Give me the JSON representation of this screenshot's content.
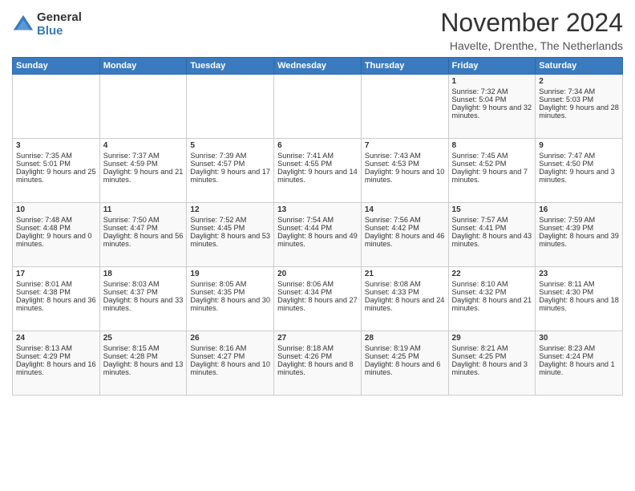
{
  "logo": {
    "general": "General",
    "blue": "Blue"
  },
  "title": "November 2024",
  "location": "Havelte, Drenthe, The Netherlands",
  "days_of_week": [
    "Sunday",
    "Monday",
    "Tuesday",
    "Wednesday",
    "Thursday",
    "Friday",
    "Saturday"
  ],
  "weeks": [
    [
      {
        "day": "",
        "content": ""
      },
      {
        "day": "",
        "content": ""
      },
      {
        "day": "",
        "content": ""
      },
      {
        "day": "",
        "content": ""
      },
      {
        "day": "",
        "content": ""
      },
      {
        "day": "1",
        "content": "Sunrise: 7:32 AM\nSunset: 5:04 PM\nDaylight: 9 hours and 32 minutes."
      },
      {
        "day": "2",
        "content": "Sunrise: 7:34 AM\nSunset: 5:03 PM\nDaylight: 9 hours and 28 minutes."
      }
    ],
    [
      {
        "day": "3",
        "content": "Sunrise: 7:35 AM\nSunset: 5:01 PM\nDaylight: 9 hours and 25 minutes."
      },
      {
        "day": "4",
        "content": "Sunrise: 7:37 AM\nSunset: 4:59 PM\nDaylight: 9 hours and 21 minutes."
      },
      {
        "day": "5",
        "content": "Sunrise: 7:39 AM\nSunset: 4:57 PM\nDaylight: 9 hours and 17 minutes."
      },
      {
        "day": "6",
        "content": "Sunrise: 7:41 AM\nSunset: 4:55 PM\nDaylight: 9 hours and 14 minutes."
      },
      {
        "day": "7",
        "content": "Sunrise: 7:43 AM\nSunset: 4:53 PM\nDaylight: 9 hours and 10 minutes."
      },
      {
        "day": "8",
        "content": "Sunrise: 7:45 AM\nSunset: 4:52 PM\nDaylight: 9 hours and 7 minutes."
      },
      {
        "day": "9",
        "content": "Sunrise: 7:47 AM\nSunset: 4:50 PM\nDaylight: 9 hours and 3 minutes."
      }
    ],
    [
      {
        "day": "10",
        "content": "Sunrise: 7:48 AM\nSunset: 4:48 PM\nDaylight: 9 hours and 0 minutes."
      },
      {
        "day": "11",
        "content": "Sunrise: 7:50 AM\nSunset: 4:47 PM\nDaylight: 8 hours and 56 minutes."
      },
      {
        "day": "12",
        "content": "Sunrise: 7:52 AM\nSunset: 4:45 PM\nDaylight: 8 hours and 53 minutes."
      },
      {
        "day": "13",
        "content": "Sunrise: 7:54 AM\nSunset: 4:44 PM\nDaylight: 8 hours and 49 minutes."
      },
      {
        "day": "14",
        "content": "Sunrise: 7:56 AM\nSunset: 4:42 PM\nDaylight: 8 hours and 46 minutes."
      },
      {
        "day": "15",
        "content": "Sunrise: 7:57 AM\nSunset: 4:41 PM\nDaylight: 8 hours and 43 minutes."
      },
      {
        "day": "16",
        "content": "Sunrise: 7:59 AM\nSunset: 4:39 PM\nDaylight: 8 hours and 39 minutes."
      }
    ],
    [
      {
        "day": "17",
        "content": "Sunrise: 8:01 AM\nSunset: 4:38 PM\nDaylight: 8 hours and 36 minutes."
      },
      {
        "day": "18",
        "content": "Sunrise: 8:03 AM\nSunset: 4:37 PM\nDaylight: 8 hours and 33 minutes."
      },
      {
        "day": "19",
        "content": "Sunrise: 8:05 AM\nSunset: 4:35 PM\nDaylight: 8 hours and 30 minutes."
      },
      {
        "day": "20",
        "content": "Sunrise: 8:06 AM\nSunset: 4:34 PM\nDaylight: 8 hours and 27 minutes."
      },
      {
        "day": "21",
        "content": "Sunrise: 8:08 AM\nSunset: 4:33 PM\nDaylight: 8 hours and 24 minutes."
      },
      {
        "day": "22",
        "content": "Sunrise: 8:10 AM\nSunset: 4:32 PM\nDaylight: 8 hours and 21 minutes."
      },
      {
        "day": "23",
        "content": "Sunrise: 8:11 AM\nSunset: 4:30 PM\nDaylight: 8 hours and 18 minutes."
      }
    ],
    [
      {
        "day": "24",
        "content": "Sunrise: 8:13 AM\nSunset: 4:29 PM\nDaylight: 8 hours and 16 minutes."
      },
      {
        "day": "25",
        "content": "Sunrise: 8:15 AM\nSunset: 4:28 PM\nDaylight: 8 hours and 13 minutes."
      },
      {
        "day": "26",
        "content": "Sunrise: 8:16 AM\nSunset: 4:27 PM\nDaylight: 8 hours and 10 minutes."
      },
      {
        "day": "27",
        "content": "Sunrise: 8:18 AM\nSunset: 4:26 PM\nDaylight: 8 hours and 8 minutes."
      },
      {
        "day": "28",
        "content": "Sunrise: 8:19 AM\nSunset: 4:25 PM\nDaylight: 8 hours and 6 minutes."
      },
      {
        "day": "29",
        "content": "Sunrise: 8:21 AM\nSunset: 4:25 PM\nDaylight: 8 hours and 3 minutes."
      },
      {
        "day": "30",
        "content": "Sunrise: 8:23 AM\nSunset: 4:24 PM\nDaylight: 8 hours and 1 minute."
      }
    ]
  ]
}
